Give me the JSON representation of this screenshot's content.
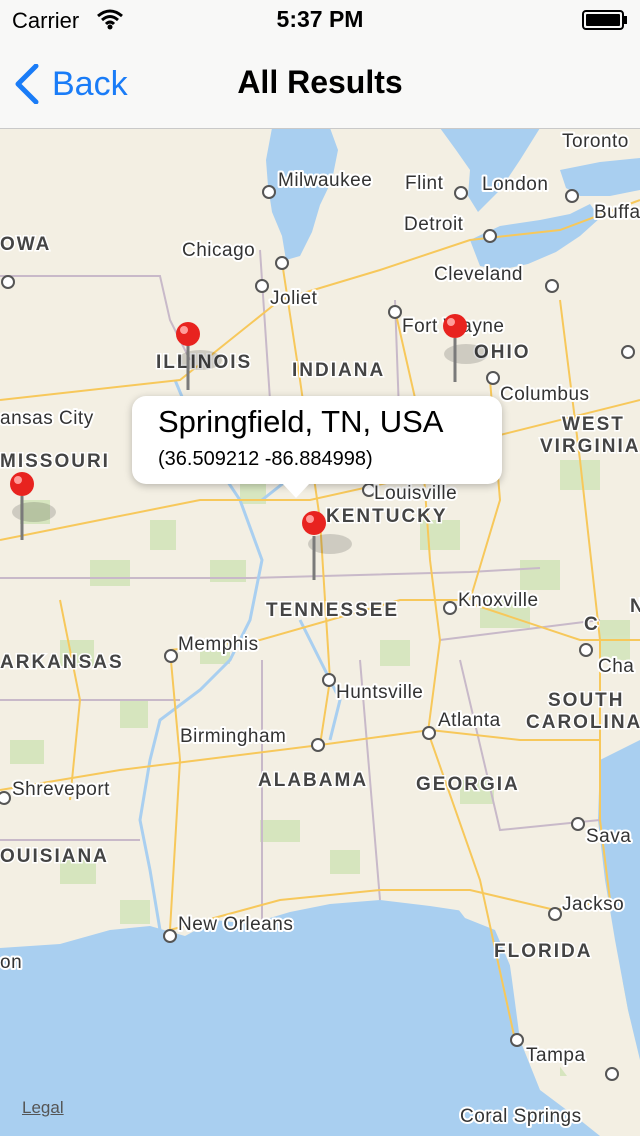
{
  "status_bar": {
    "carrier": "Carrier",
    "time": "5:37 PM"
  },
  "nav": {
    "back_label": "Back",
    "title": "All Results"
  },
  "map": {
    "cities": [
      "Toronto",
      "Milwaukee",
      "Flint",
      "London",
      "Buffa",
      "Detroit",
      "Chicago",
      "Joliet",
      "Cleveland",
      "Fort Wayne",
      "Columbus",
      "ansas City",
      "Louisville",
      "Knoxville",
      "Memphis",
      "Huntsville",
      "Atlanta",
      "Cha",
      "Birmingham",
      "Shreveport",
      "Sava",
      "Jackso",
      "New Orleans",
      "on",
      "Tampa",
      "Coral Springs"
    ],
    "states": [
      "OWA",
      "ILLINOIS",
      "INDIANA",
      "OHIO",
      "WEST",
      "VIRGINIA",
      "MISSOURI",
      "KENTUCKY",
      "TENNESSEE",
      "ARKANSAS",
      "SOUTH",
      "CAROLINA",
      "ALABAMA",
      "GEORGIA",
      "OUISIANA",
      "FLORIDA",
      "N",
      "C"
    ]
  },
  "callout": {
    "title": "Springfield, TN, USA",
    "coords": "(36.509212 -86.884998)"
  },
  "legal": "Legal",
  "colors": {
    "accent": "#1a7cf7",
    "pin": "#e8231f",
    "water": "#a9cff0",
    "land": "#f3efe3"
  }
}
